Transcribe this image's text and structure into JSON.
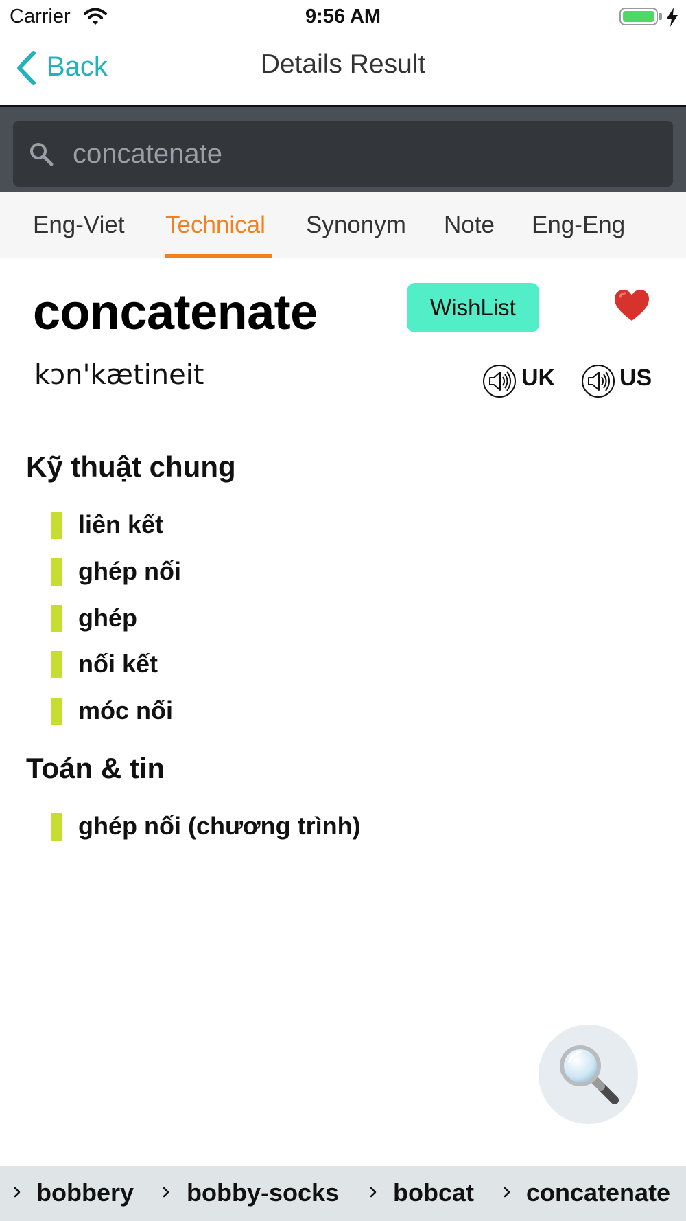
{
  "status_bar": {
    "carrier": "Carrier",
    "time": "9:56 AM"
  },
  "nav": {
    "back_label": "Back",
    "title": "Details Result"
  },
  "search": {
    "value": "concatenate",
    "placeholder": "concatenate"
  },
  "tabs": [
    {
      "label": "Eng-Viet"
    },
    {
      "label": "Technical",
      "active": true
    },
    {
      "label": "Synonym"
    },
    {
      "label": "Note"
    },
    {
      "label": "Eng-Eng"
    }
  ],
  "word": {
    "headword": "concatenate",
    "phonetic": "kɔn'kætineit",
    "wishlist_label": "WishList",
    "uk_label": "UK",
    "us_label": "US"
  },
  "sections": [
    {
      "title": "Kỹ thuật chung",
      "items": [
        "liên kết",
        "ghép nối",
        "ghép",
        "nối kết",
        "móc nối"
      ]
    },
    {
      "title": "Toán & tin",
      "items": [
        "ghép nối (chương trình)"
      ]
    }
  ],
  "history": [
    "bobbery",
    "bobby-socks",
    "bobcat",
    "concatenate"
  ],
  "colors": {
    "accent_teal": "#21b3bb",
    "active_tab": "#f37f1d",
    "wishlist_bg": "#52eec7",
    "def_marker": "#c7dd2f",
    "heart": "#d7332c"
  },
  "icons": {
    "back": "chevron-left-icon",
    "search": "search-icon",
    "favorite": "heart-icon",
    "audio": "speaker-icon",
    "fab": "magnifying-glass-icon"
  }
}
